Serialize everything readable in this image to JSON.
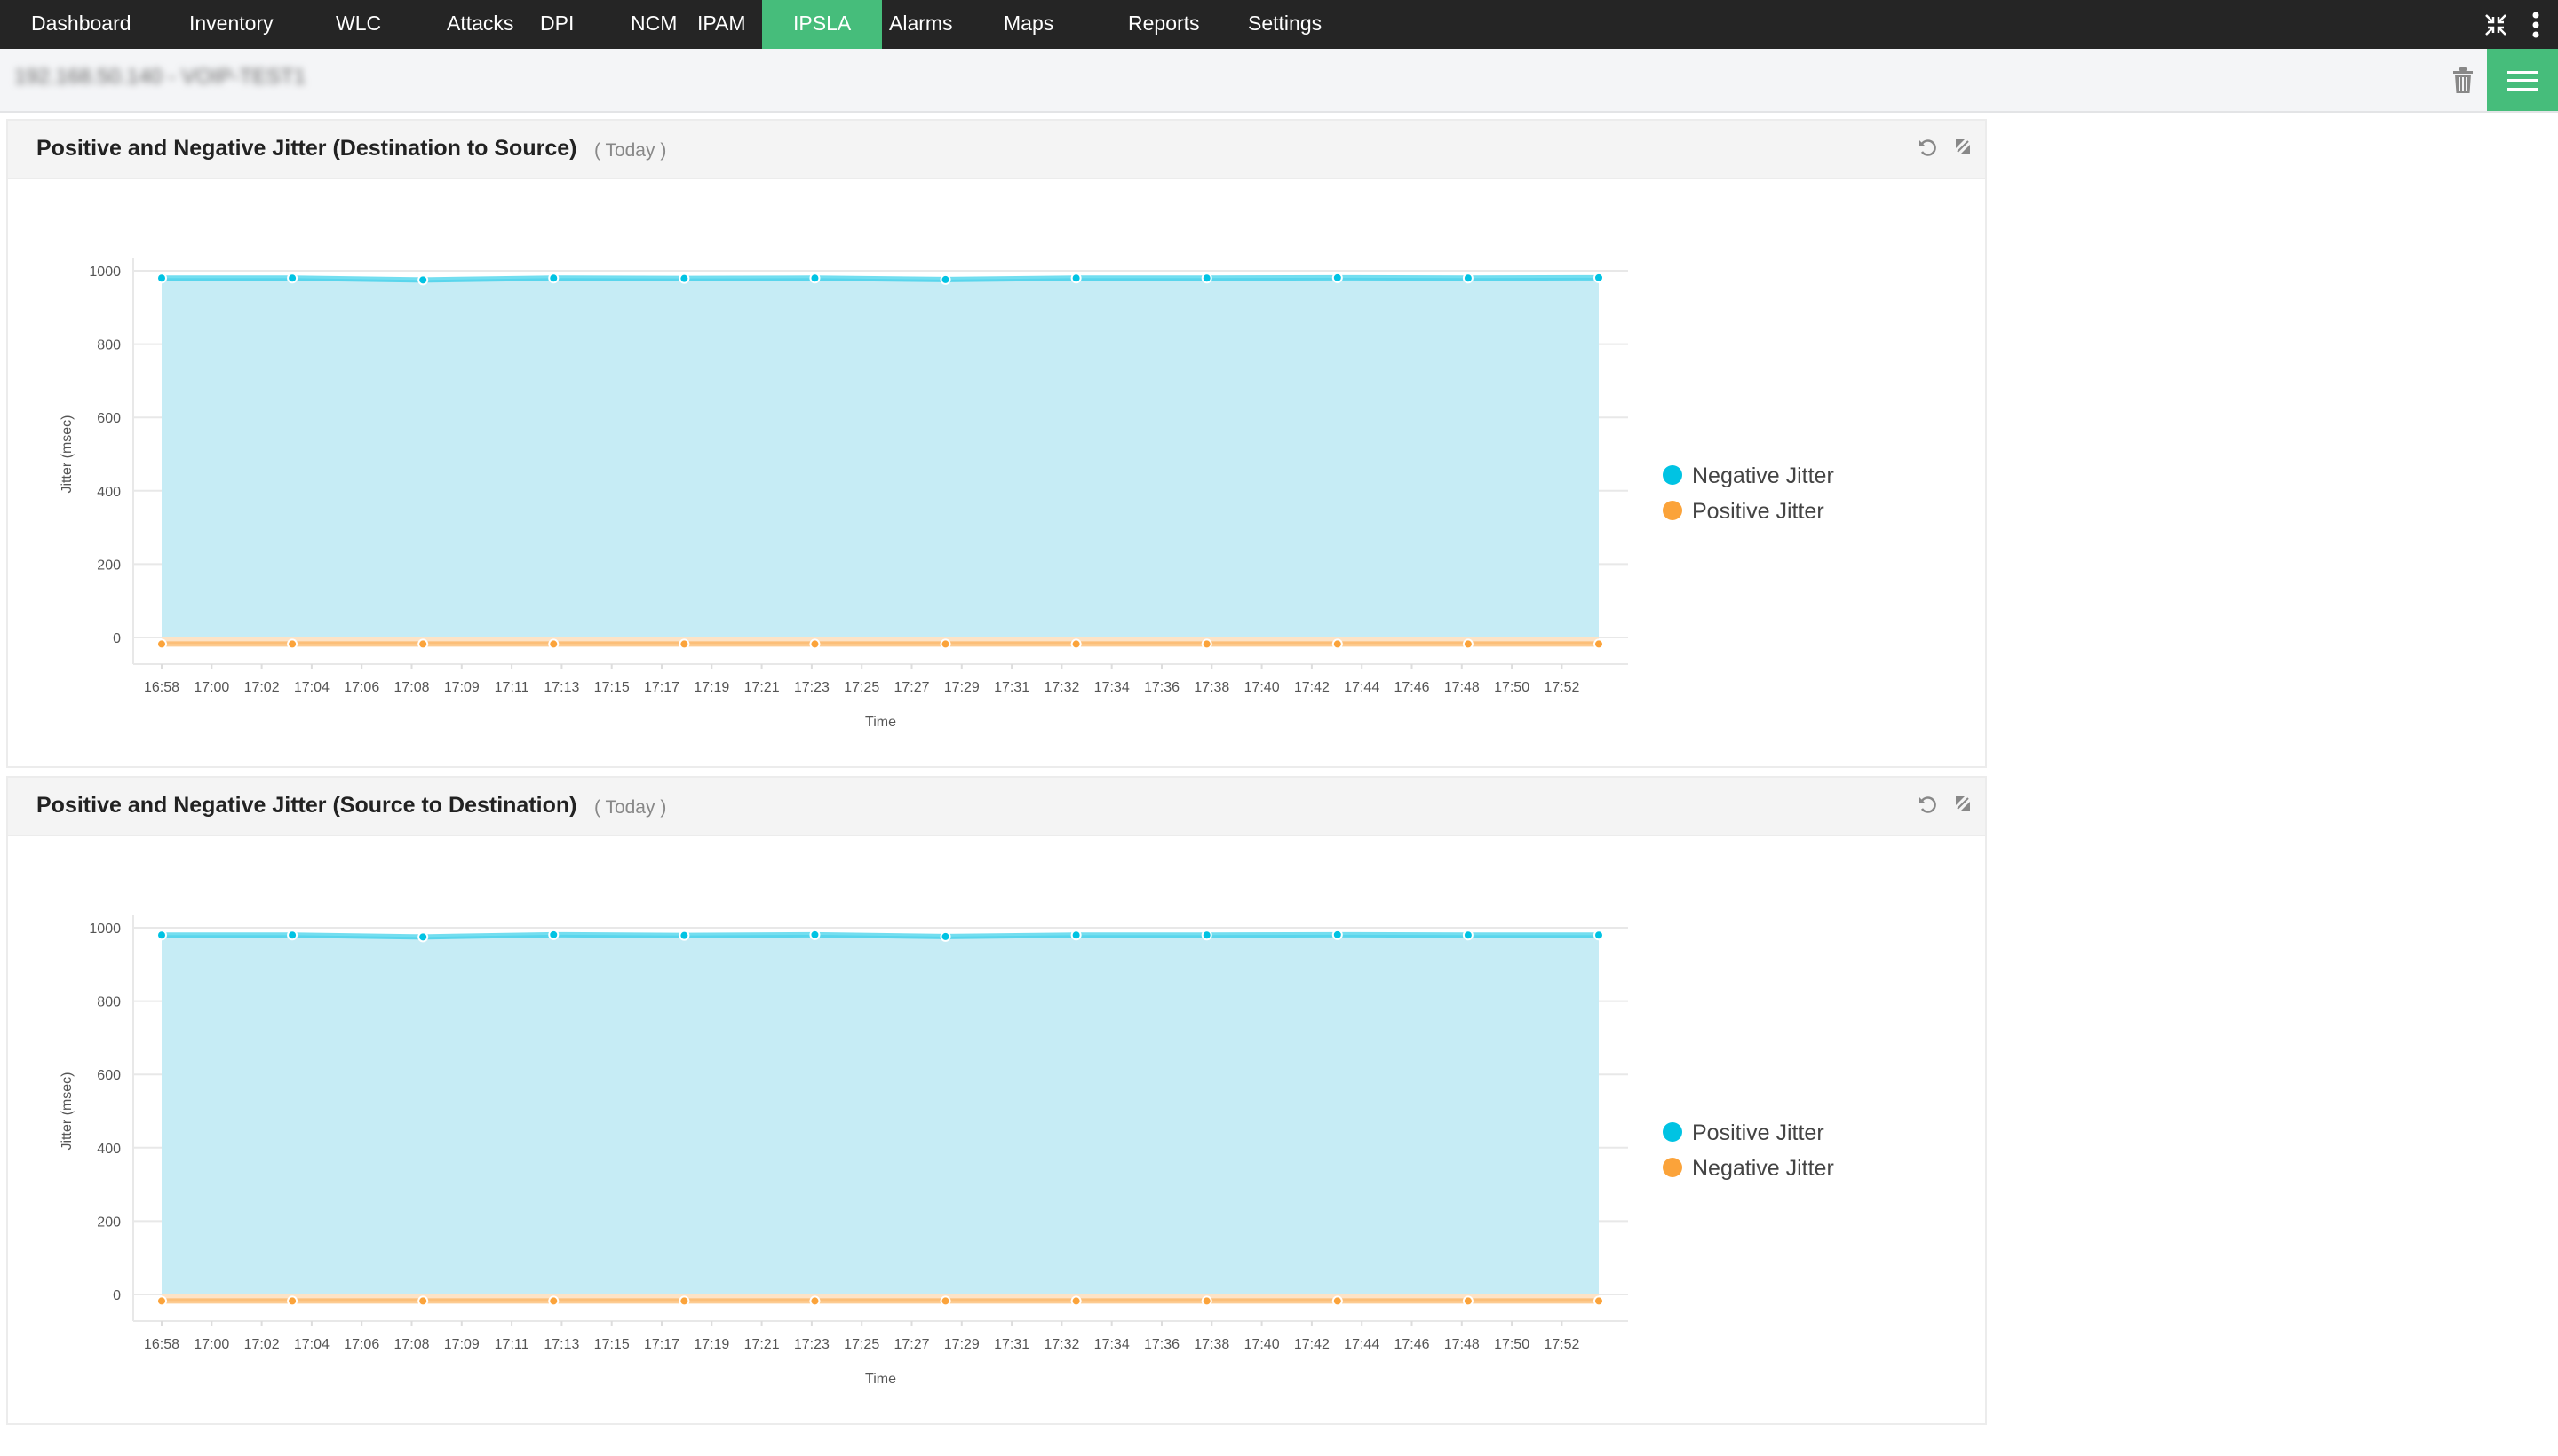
{
  "nav": {
    "items": [
      "Dashboard",
      "Inventory",
      "WLC",
      "Attacks",
      "DPI",
      "NCM",
      "IPAM",
      "IPSLA",
      "Alarms",
      "Maps",
      "Reports",
      "Settings"
    ],
    "active": "IPSLA",
    "icons": [
      "collapse-icon",
      "more-vertical-icon"
    ]
  },
  "subheader": {
    "device": "192.168.50.140 - VOIP-TEST1",
    "icons": [
      "trash-icon",
      "menu-icon"
    ]
  },
  "colors": {
    "nav_bg": "#252525",
    "accent": "#46bd7b",
    "series_blue": "#00c3e3",
    "series_orange": "#fba33a"
  },
  "panels": [
    {
      "title": "Positive and Negative Jitter (Destination to Source)",
      "period": "( Today )",
      "icons": [
        "refresh-icon",
        "expand-icon"
      ]
    },
    {
      "title": "Positive and Negative Jitter (Source to Destination)",
      "period": "( Today )",
      "icons": [
        "refresh-icon",
        "expand-icon"
      ]
    }
  ],
  "chart_data": [
    {
      "type": "area",
      "ylabel": "Jitter (msec)",
      "xlabel": "Time",
      "ylim": [
        0,
        1000
      ],
      "yticks": [
        0,
        200,
        400,
        600,
        800,
        1000
      ],
      "grid": true,
      "legend": "right",
      "x_ticks": [
        "16:58",
        "17:00",
        "17:02",
        "17:04",
        "17:06",
        "17:08",
        "17:09",
        "17:11",
        "17:13",
        "17:15",
        "17:17",
        "17:19",
        "17:21",
        "17:23",
        "17:25",
        "17:27",
        "17:29",
        "17:31",
        "17:32",
        "17:34",
        "17:36",
        "17:38",
        "17:40",
        "17:42",
        "17:44",
        "17:46",
        "17:48",
        "17:50",
        "17:52"
      ],
      "series": [
        {
          "name": "Negative Jitter",
          "color": "#00c3e3",
          "values": [
            980,
            980,
            975,
            980,
            979,
            980,
            976,
            980,
            980,
            981,
            980,
            981
          ]
        },
        {
          "name": "Positive Jitter",
          "color": "#fba33a",
          "values": [
            -18,
            -18,
            -18,
            -18,
            -18,
            -18,
            -18,
            -18,
            -18,
            -18,
            -18,
            -18
          ]
        }
      ]
    },
    {
      "type": "area",
      "ylabel": "Jitter (msec)",
      "xlabel": "Time",
      "ylim": [
        0,
        1000
      ],
      "yticks": [
        0,
        200,
        400,
        600,
        800,
        1000
      ],
      "grid": true,
      "legend": "right",
      "x_ticks": [
        "16:58",
        "17:00",
        "17:02",
        "17:04",
        "17:06",
        "17:08",
        "17:09",
        "17:11",
        "17:13",
        "17:15",
        "17:17",
        "17:19",
        "17:21",
        "17:23",
        "17:25",
        "17:27",
        "17:29",
        "17:31",
        "17:32",
        "17:34",
        "17:36",
        "17:38",
        "17:40",
        "17:42",
        "17:44",
        "17:46",
        "17:48",
        "17:50",
        "17:52"
      ],
      "series": [
        {
          "name": "Positive Jitter",
          "color": "#00c3e3",
          "values": [
            980,
            980,
            975,
            981,
            979,
            981,
            976,
            980,
            980,
            981,
            980,
            980
          ]
        },
        {
          "name": "Negative Jitter",
          "color": "#fba33a",
          "values": [
            -18,
            -18,
            -18,
            -18,
            -18,
            -18,
            -18,
            -18,
            -18,
            -18,
            -18,
            -18
          ]
        }
      ]
    }
  ]
}
